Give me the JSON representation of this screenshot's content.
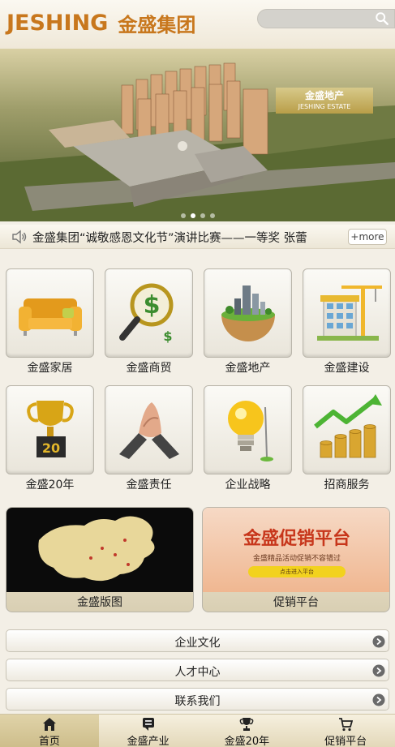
{
  "header": {
    "logo_en": "JESHING",
    "logo_cn": "金盛集团",
    "search_placeholder": ""
  },
  "banner": {
    "badge_cn": "金盛地产",
    "badge_en": "JESHING ESTATE",
    "slide_count": 4,
    "active_slide": 2
  },
  "ticker": {
    "news": "金盛集团“诚敬感恩文化节”演讲比赛——一等奖 张蕾",
    "more": "+more"
  },
  "grid": [
    {
      "label": "金盛家居",
      "icon": "sofa-icon"
    },
    {
      "label": "金盛商贸",
      "icon": "magnifier-dollar-icon"
    },
    {
      "label": "金盛地产",
      "icon": "globe-buildings-icon"
    },
    {
      "label": "金盛建设",
      "icon": "construction-crane-icon"
    },
    {
      "label": "金盛20年",
      "icon": "trophy-icon"
    },
    {
      "label": "金盛责任",
      "icon": "handshake-icon"
    },
    {
      "label": "企业战略",
      "icon": "lightbulb-icon"
    },
    {
      "label": "招商服务",
      "icon": "coins-growth-icon"
    }
  ],
  "cards": [
    {
      "label": "金盛版图",
      "icon": "china-map-icon"
    },
    {
      "label": "促销平台",
      "title": "金盛促销平台",
      "subtitle": "金盛精品活动促销不容错过",
      "button": "点击进入平台"
    }
  ],
  "rows": [
    {
      "label": "企业文化"
    },
    {
      "label": "人才中心"
    },
    {
      "label": "联系我们"
    }
  ],
  "nav": [
    {
      "label": "首页",
      "icon": "home-icon",
      "active": true
    },
    {
      "label": "金盛产业",
      "icon": "industry-icon",
      "active": false
    },
    {
      "label": "金盛20年",
      "icon": "trophy-icon",
      "active": false
    },
    {
      "label": "促销平台",
      "icon": "cart-icon",
      "active": false
    }
  ],
  "colors": {
    "brand": "#c8771d",
    "background": "#f3efe6",
    "nav_active": "#d6c79a"
  }
}
